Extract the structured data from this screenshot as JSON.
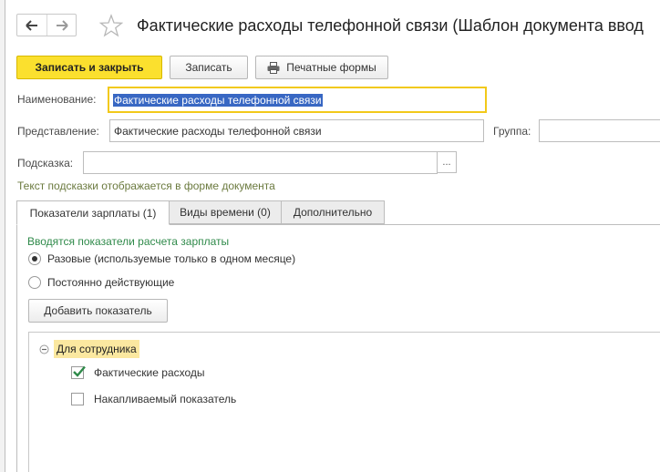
{
  "title": "Фактические расходы телефонной связи (Шаблон документа ввод",
  "nav": {
    "back_icon": "arrow-left-icon",
    "forward_icon": "arrow-right-icon",
    "favorite_icon": "star-icon"
  },
  "toolbar": {
    "save_close_label": "Записать и закрыть",
    "save_label": "Записать",
    "print_label": "Печатные формы",
    "print_icon": "printer-icon"
  },
  "form": {
    "name_label": "Наименование:",
    "name_value": "Фактические расходы телефонной связи",
    "representation_label": "Представление:",
    "representation_value": "Фактические расходы телефонной связи",
    "group_label": "Группа:",
    "group_value": "",
    "hint_label": "Подсказка:",
    "hint_value": "",
    "hint_button": "...",
    "hint_note": "Текст подсказки отображается в форме документа"
  },
  "tabs": [
    {
      "label": "Показатели зарплаты (1)",
      "active": true
    },
    {
      "label": "Виды времени (0)",
      "active": false
    },
    {
      "label": "Дополнительно",
      "active": false
    }
  ],
  "panel": {
    "title": "Вводятся показатели расчета зарплаты",
    "radio_options": [
      {
        "label": "Разовые (используемые только в одном месяце)",
        "selected": true
      },
      {
        "label": "Постоянно действующие",
        "selected": false
      }
    ],
    "add_button": "Добавить показатель"
  },
  "tree": {
    "group_label": "Для сотрудника",
    "items": [
      {
        "label": "Фактические расходы",
        "checked": true
      },
      {
        "label": "Накапливаемый показатель",
        "checked": false
      }
    ]
  },
  "colors": {
    "primary_button": "#fbe02e",
    "selection": "#3867c3",
    "hint_text": "#6b7a3f",
    "section_title": "#2f8a4a",
    "check_mark": "#2f8a4a",
    "group_highlight": "#fbe8a0"
  }
}
